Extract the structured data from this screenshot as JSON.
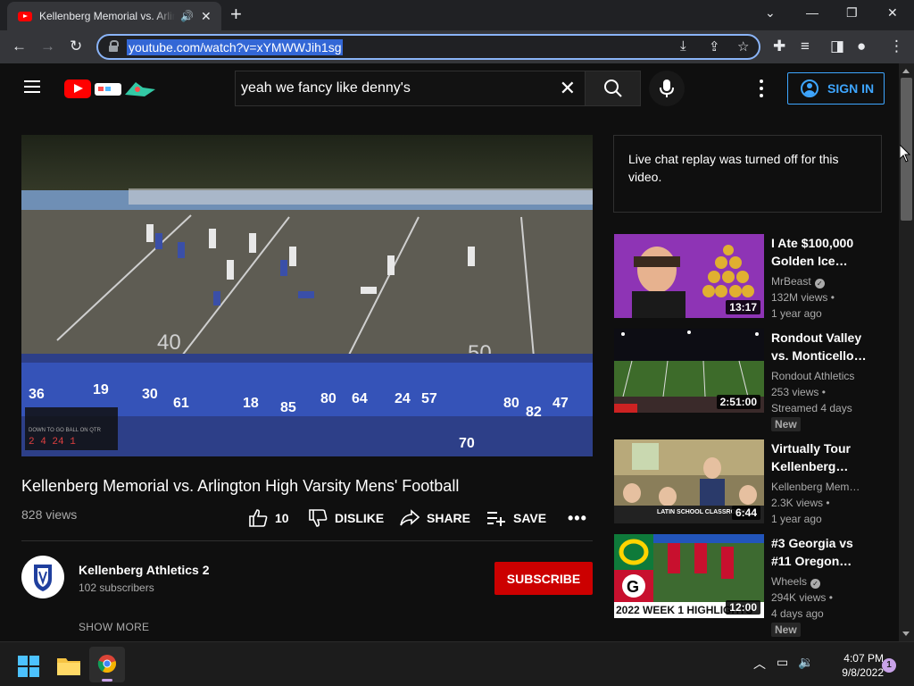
{
  "browser": {
    "tab_title": "Kellenberg Memorial vs. Arlington High Varsity Mens' Football",
    "url": "youtube.com/watch?v=xYMWWJih1sg"
  },
  "header": {
    "search_value": "yeah we fancy like denny's",
    "sign_in_label": "SIGN IN"
  },
  "video": {
    "title": "Kellenberg Memorial vs. Arlington High Varsity Mens' Football",
    "views": "828 views",
    "like_count": "10",
    "dislike_label": "DISLIKE",
    "share_label": "SHARE",
    "save_label": "SAVE",
    "scoreboard": {
      "row1": "DOWN  TO GO  BALL ON  QTR",
      "row2": "2  4  24  1"
    },
    "jerseys": [
      "36",
      "19",
      "30",
      "61",
      "18",
      "85",
      "80",
      "64",
      "24",
      "57",
      "80",
      "70",
      "82",
      "47"
    ],
    "yard_numbers": [
      "40",
      "50"
    ]
  },
  "channel": {
    "name": "Kellenberg Athletics 2",
    "subscribers": "102 subscribers",
    "subscribe_label": "SUBSCRIBE",
    "show_more_label": "SHOW MORE"
  },
  "chat": {
    "message": "Live chat replay was turned off for this video."
  },
  "recommendations": [
    {
      "title": "I Ate $100,000 Golden Ice…",
      "channel": "MrBeast",
      "verified": true,
      "views": "132M views",
      "age": "1 year ago",
      "duration": "13:17",
      "badge": ""
    },
    {
      "title": "Rondout Valley vs. Monticello…",
      "channel": "Rondout Athletics",
      "verified": false,
      "views": "253 views",
      "age": "Streamed 4 days",
      "duration": "2:51:00",
      "badge": "New"
    },
    {
      "title": "Virtually Tour Kellenberg…",
      "channel": "Kellenberg Mem…",
      "verified": false,
      "views": "2.3K views",
      "age": "1 year ago",
      "duration": "6:44",
      "badge": "",
      "thumb_caption": "LATIN SCHOOL CLASSROOM"
    },
    {
      "title": "#3 Georgia vs #11 Oregon…",
      "channel": "Wheels",
      "verified": true,
      "views": "294K views",
      "age": "4 days ago",
      "duration": "12:00",
      "badge": "New",
      "thumb_caption": "2022 WEEK 1 HIGHLIGHTS"
    }
  ],
  "taskbar": {
    "time": "4:07 PM",
    "date": "9/8/2022",
    "notifications": "1"
  },
  "colors": {
    "youtube_red": "#ff0000",
    "subscribe_red": "#cc0000",
    "link_blue": "#3ea6ff",
    "background": "#0f0f0f"
  }
}
